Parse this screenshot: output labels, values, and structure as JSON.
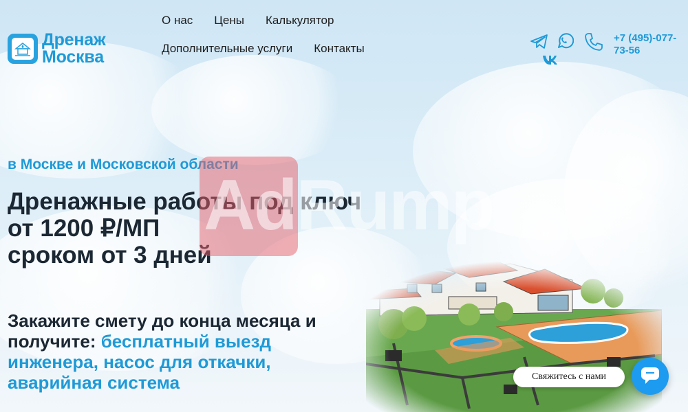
{
  "brand": {
    "line1": "Дренаж",
    "line2": "Москва",
    "logo_icon": "drainage-logo-icon",
    "color": "#1f9ad6"
  },
  "nav": {
    "row1": [
      "О нас",
      "Цены",
      "Калькулятор"
    ],
    "row2": [
      "Дополнительные услуги",
      "Контакты"
    ]
  },
  "socials": [
    "telegram-icon",
    "whatsapp-icon",
    "vk-icon"
  ],
  "phone": {
    "icon": "phone-icon",
    "number": "+7 (495)-077-73-56"
  },
  "hero": {
    "subtitle": "в Москве и Московской области",
    "title_lines": [
      "Дренажные работы под ключ",
      "от 1200 ₽/МП",
      "сроком от 3 дней"
    ],
    "offer_prefix": "Закажите смету до конца месяца и получите:",
    "offer_highlight": "бесплатный выезд инженера, насос для откачки, аварийная система"
  },
  "watermark": {
    "text": "AdRump"
  },
  "contact_widget": {
    "label": "Свяжитесь с нами",
    "icon": "chat-icon",
    "color": "#1d9bf0"
  }
}
